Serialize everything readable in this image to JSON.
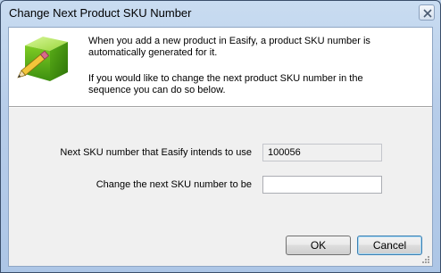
{
  "window": {
    "title": "Change Next Product SKU Number",
    "close_icon": "close-icon"
  },
  "info": {
    "icon": "green-cube-pencil-icon",
    "line1": "When you add a new product in Easify, a product SKU number is automatically generated for it.",
    "line2": "If you would like to change the next product SKU number in the sequence you can do so below."
  },
  "form": {
    "next_sku_label": "Next SKU number that Easify intends to use",
    "next_sku_value": "100056",
    "change_label": "Change the next SKU number to be",
    "change_value": ""
  },
  "buttons": {
    "ok": "OK",
    "cancel": "Cancel"
  }
}
